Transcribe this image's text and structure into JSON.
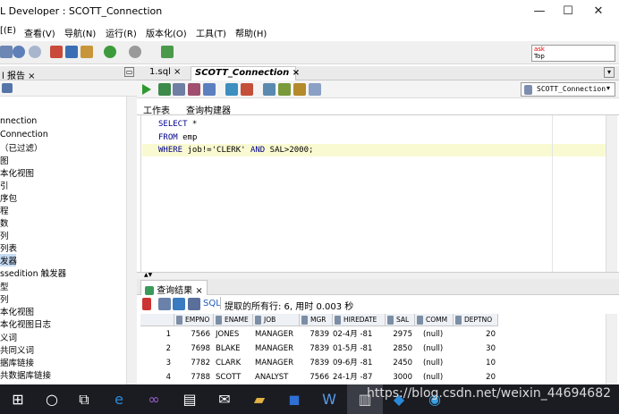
{
  "window": {
    "title": "L Developer : SCOTT_Connection",
    "minimize": "—",
    "maximize": "☐",
    "close": "✕"
  },
  "menu": [
    "[(E)",
    "查看(V)",
    "导航(N)",
    "运行(R)",
    "版本化(O)",
    "工具(T)",
    "帮助(H)"
  ],
  "sql_search": {
    "line1": "ask",
    "line2": "Top"
  },
  "left_panel": {
    "tab_label": "l 报告  ×",
    "minimize_btn": "▭",
    "tree": [
      "nnection",
      "Connection",
      "（已过滤）",
      "图",
      "本化视图",
      "引",
      "序包",
      "程",
      "数",
      "列",
      "列表",
      "发器",
      "ssedition 触发器",
      "型",
      "列",
      "本化视图",
      "本化视图日志",
      "义词",
      "共同义词",
      "据库链接",
      "共数据库链接"
    ]
  },
  "doc_tabs": [
    {
      "label": "1.sql ×"
    },
    {
      "label": "SCOTT_Connection ×"
    }
  ],
  "connection_selector": "SCOTT_Connection",
  "worksheet_tabs": [
    "工作表",
    "查询构建器"
  ],
  "editor": {
    "lines": [
      {
        "kw": "SELECT",
        "rest": " *"
      },
      {
        "kw": "FROM",
        "rest": " emp"
      },
      {
        "kw1": "WHERE",
        "mid1": " job!=",
        "str": "'CLERK'",
        "kw2": " AND",
        "mid2": " SAL>",
        "num": "2000",
        "end": ";"
      }
    ]
  },
  "results": {
    "tab_label": "查询结果  ×",
    "sql_label": "SQL",
    "status": "提取的所有行: 6, 用时 0.003 秒",
    "columns": [
      "EMPNO",
      "ENAME",
      "JOB",
      "MGR",
      "HIREDATE",
      "SAL",
      "COMM",
      "DEPTNO"
    ],
    "rows": [
      [
        "1",
        "7566",
        "JONES",
        "MANAGER",
        "7839",
        "02-4月 -81",
        "2975",
        "(null)",
        "20"
      ],
      [
        "2",
        "7698",
        "BLAKE",
        "MANAGER",
        "7839",
        "01-5月 -81",
        "2850",
        "(null)",
        "30"
      ],
      [
        "3",
        "7782",
        "CLARK",
        "MANAGER",
        "7839",
        "09-6月 -81",
        "2450",
        "(null)",
        "10"
      ],
      [
        "4",
        "7788",
        "SCOTT",
        "ANALYST",
        "7566",
        "24-1月 -87",
        "3000",
        "(null)",
        "20"
      ]
    ]
  },
  "taskbar": {
    "watermark": "https://blog.csdn.net/weixin_44694682"
  },
  "colors": {
    "accent_blue": "#1e5bb8",
    "keyword": "#00008b",
    "current_line": "#fafad2",
    "taskbar": "#1a1c22"
  }
}
